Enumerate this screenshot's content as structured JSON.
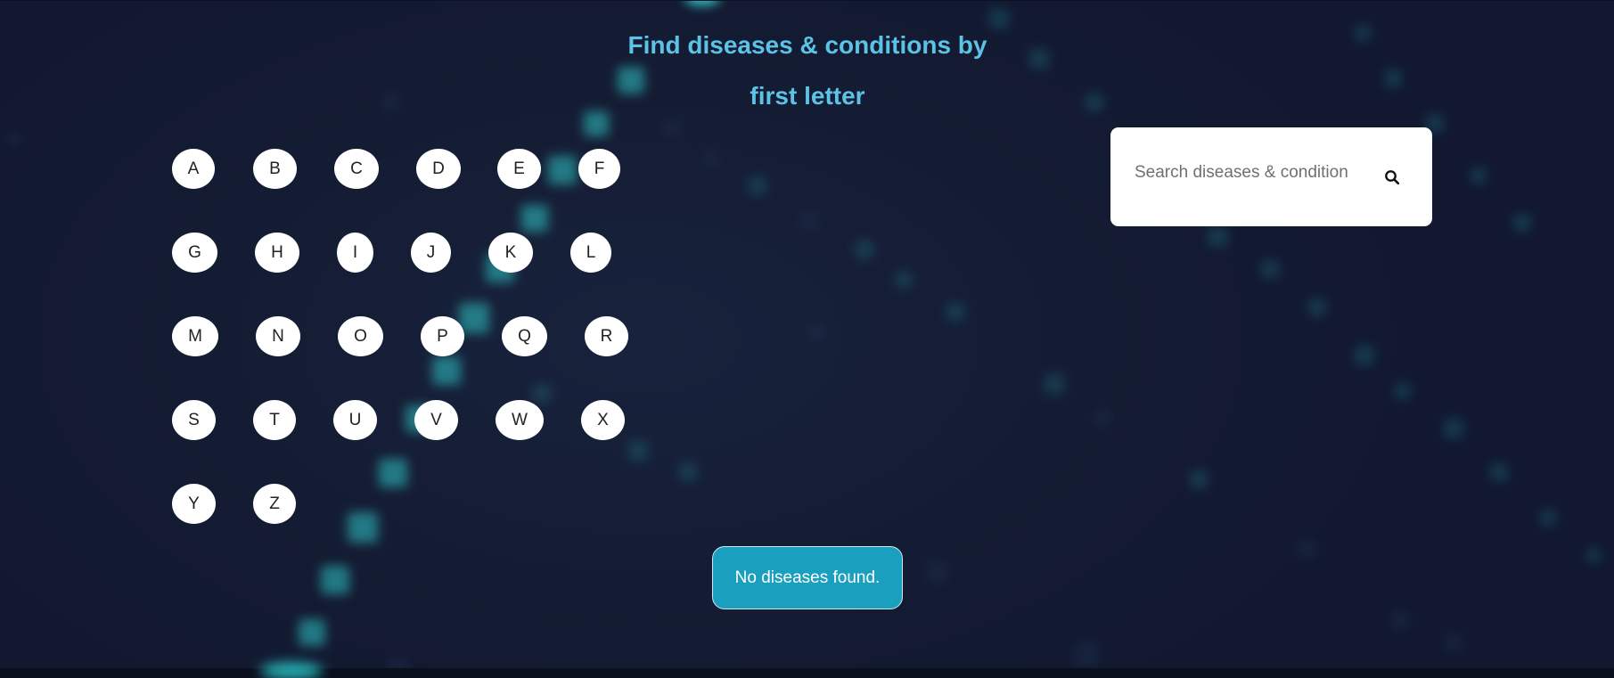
{
  "header": {
    "title_line1": "Find diseases & conditions by",
    "title_line2": "first letter"
  },
  "letters": [
    "A",
    "B",
    "C",
    "D",
    "E",
    "F",
    "G",
    "H",
    "I",
    "J",
    "K",
    "L",
    "M",
    "N",
    "O",
    "P",
    "Q",
    "R",
    "S",
    "T",
    "U",
    "V",
    "W",
    "X",
    "Y",
    "Z"
  ],
  "search": {
    "placeholder": "Search diseases & condition",
    "icon": "search-icon"
  },
  "status": {
    "message": "No diseases found."
  },
  "colors": {
    "background": "#131b31",
    "title": "#5cc3e6",
    "status_bg": "#1b9fbe",
    "particle": "#2fc6c6"
  }
}
